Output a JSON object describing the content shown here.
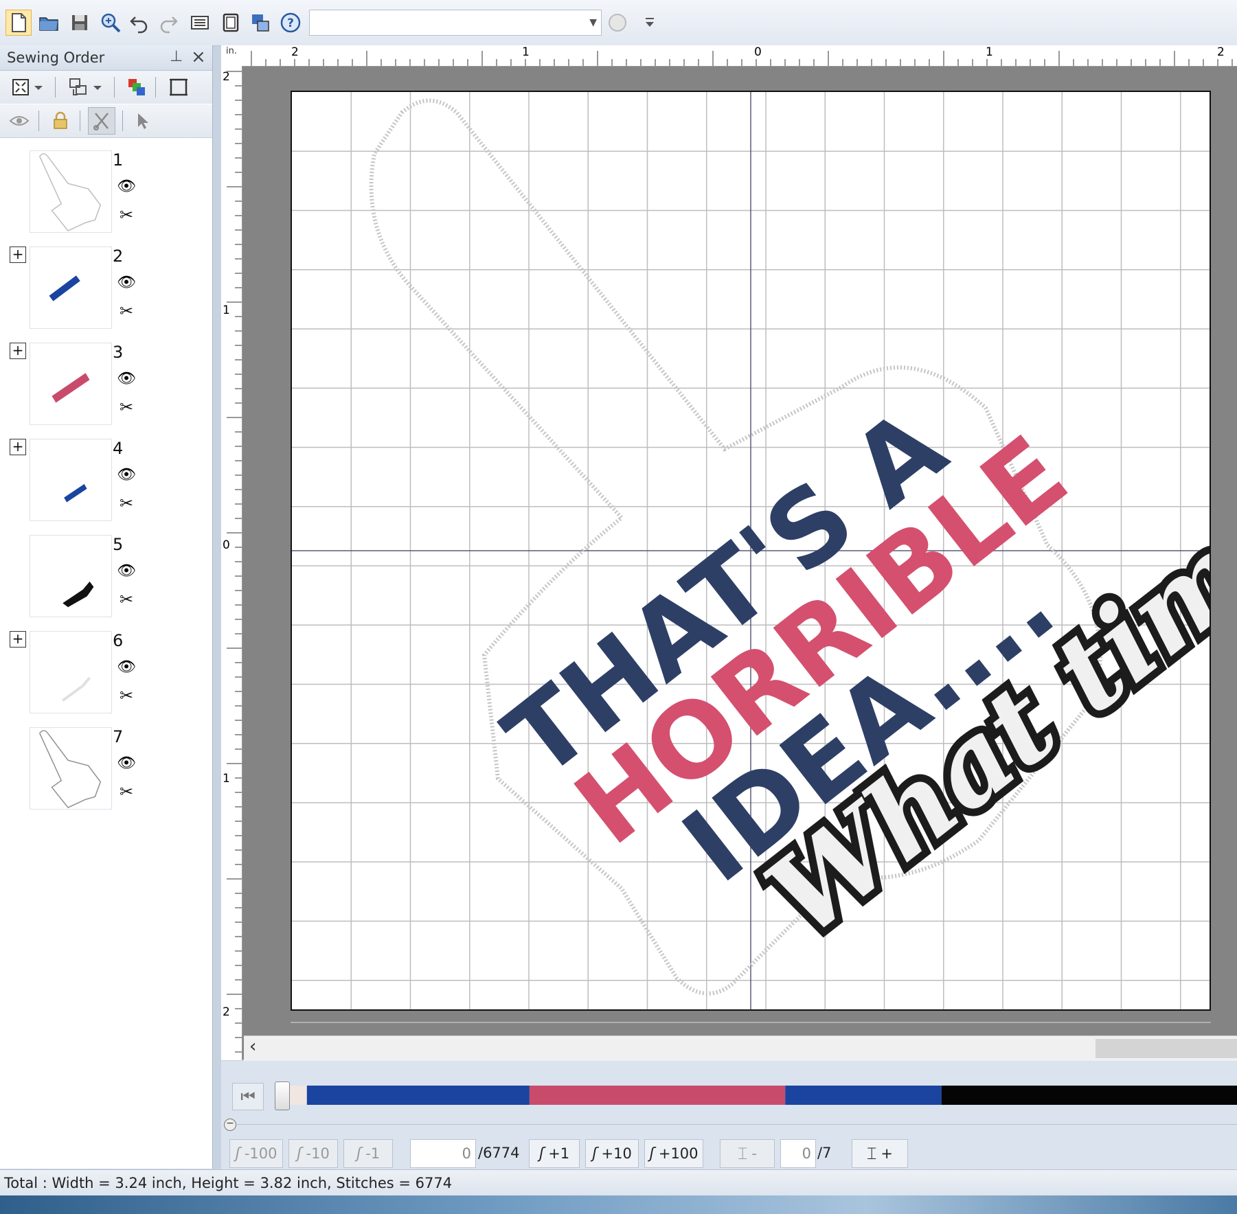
{
  "toolbar": {
    "buttons": [
      "new-icon",
      "open-folder-icon",
      "save-icon",
      "zoom-icon",
      "undo-icon",
      "redo-icon",
      "design-property-icon",
      "hoop-icon",
      "transfer-icon",
      "help-icon"
    ],
    "combo_value": ""
  },
  "panel": {
    "title": "Sewing Order",
    "items": [
      {
        "num": "1",
        "expandable": false,
        "color": "#cfcfcf"
      },
      {
        "num": "2",
        "expandable": true,
        "color": "#1a44a0"
      },
      {
        "num": "3",
        "expandable": true,
        "color": "#c94b6b"
      },
      {
        "num": "4",
        "expandable": true,
        "color": "#1a44a0"
      },
      {
        "num": "5",
        "expandable": false,
        "color": "#111111"
      },
      {
        "num": "6",
        "expandable": true,
        "color": "#e8e8e8"
      },
      {
        "num": "7",
        "expandable": false,
        "color": "#9a9a9a"
      }
    ]
  },
  "ruler": {
    "unit": "in.",
    "top_labels": [
      "2",
      "1",
      "0",
      "1",
      "2"
    ],
    "left_labels": [
      "2",
      "1",
      "0",
      "1",
      "2"
    ]
  },
  "design": {
    "line1": "THAT'S A",
    "line2": "HORRIBLE",
    "line3": "IDEA....",
    "line4": "What time?",
    "navy": "#2e3f66",
    "pink": "#d4506e",
    "black": "#1c1c1c",
    "white": "#f4f4f4"
  },
  "stitch_controls": {
    "back100": "-100",
    "back10": "-10",
    "back1": "-1",
    "stitch_current": "0",
    "stitch_total": "/6774",
    "fwd1": "+1",
    "fwd10": "+10",
    "fwd100": "+100",
    "color_minus": "-",
    "color_current": "0",
    "color_total": "/7",
    "color_plus": "+"
  },
  "color_bar": [
    "#f0e6e2",
    "#1a44a0",
    "#c94b6b",
    "#1a44a0",
    "#050505"
  ],
  "status": {
    "text": "Total : Width = 3.24 inch, Height = 3.82 inch, Stitches = 6774"
  }
}
